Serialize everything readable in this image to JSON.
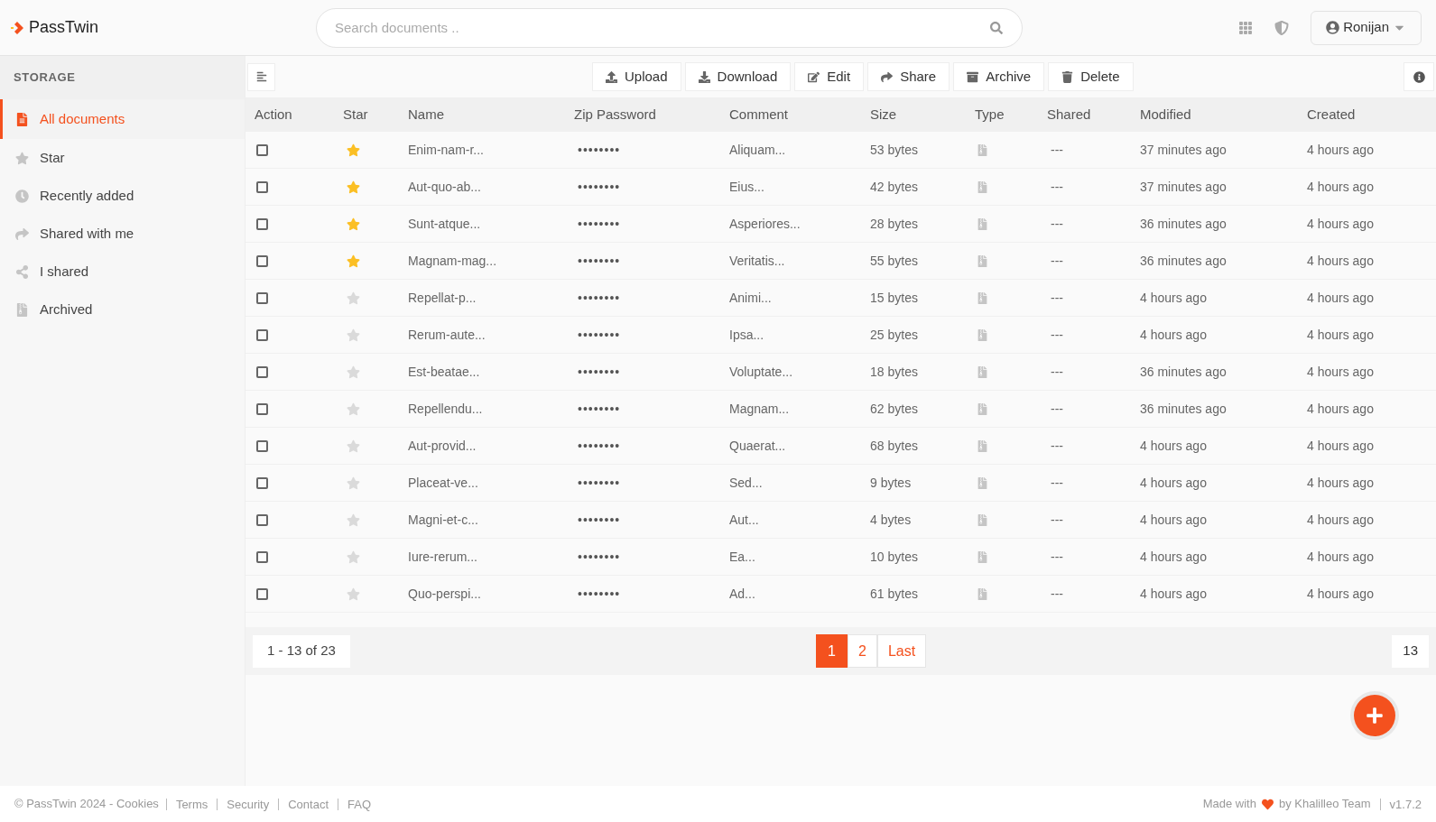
{
  "brand": "PassTwin",
  "search": {
    "placeholder": "Search documents .."
  },
  "user": {
    "name": "Ronijan"
  },
  "sidebar": {
    "heading": "STORAGE",
    "items": [
      {
        "label": "All documents",
        "selected": true,
        "kind": "file"
      },
      {
        "label": "Star",
        "selected": false,
        "kind": "star"
      },
      {
        "label": "Recently added",
        "selected": false,
        "kind": "clock"
      },
      {
        "label": "Shared with me",
        "selected": false,
        "kind": "share"
      },
      {
        "label": "I shared",
        "selected": false,
        "kind": "network"
      },
      {
        "label": "Archived",
        "selected": false,
        "kind": "zip"
      }
    ]
  },
  "toolbar": [
    {
      "label": "Upload",
      "kind": "upload"
    },
    {
      "label": "Download",
      "kind": "download"
    },
    {
      "label": "Edit",
      "kind": "edit"
    },
    {
      "label": "Share",
      "kind": "share"
    },
    {
      "label": "Archive",
      "kind": "archive"
    },
    {
      "label": "Delete",
      "kind": "delete"
    }
  ],
  "table": {
    "columns": [
      "Action",
      "Star",
      "Name",
      "Zip Password",
      "Comment",
      "Size",
      "Type",
      "Shared",
      "Modified",
      "Created"
    ],
    "rows": [
      {
        "checked": false,
        "starred": true,
        "name": "Enim-nam-r...",
        "password": "••••••••",
        "comment": "Aliquam...",
        "size": "53 bytes",
        "shared": "---",
        "modified": "37 minutes ago",
        "created": "4 hours ago"
      },
      {
        "checked": false,
        "starred": true,
        "name": "Aut-quo-ab...",
        "password": "••••••••",
        "comment": "Eius...",
        "size": "42 bytes",
        "shared": "---",
        "modified": "37 minutes ago",
        "created": "4 hours ago"
      },
      {
        "checked": false,
        "starred": true,
        "name": "Sunt-atque...",
        "password": "••••••••",
        "comment": "Asperiores...",
        "size": "28 bytes",
        "shared": "---",
        "modified": "36 minutes ago",
        "created": "4 hours ago"
      },
      {
        "checked": false,
        "starred": true,
        "name": "Magnam-mag...",
        "password": "••••••••",
        "comment": "Veritatis...",
        "size": "55 bytes",
        "shared": "---",
        "modified": "36 minutes ago",
        "created": "4 hours ago"
      },
      {
        "checked": false,
        "starred": false,
        "name": "Repellat-p...",
        "password": "••••••••",
        "comment": "Animi...",
        "size": "15 bytes",
        "shared": "---",
        "modified": "4 hours ago",
        "created": "4 hours ago"
      },
      {
        "checked": false,
        "starred": false,
        "name": "Rerum-aute...",
        "password": "••••••••",
        "comment": "Ipsa...",
        "size": "25 bytes",
        "shared": "---",
        "modified": "4 hours ago",
        "created": "4 hours ago"
      },
      {
        "checked": false,
        "starred": false,
        "name": "Est-beatae...",
        "password": "••••••••",
        "comment": "Voluptate...",
        "size": "18 bytes",
        "shared": "---",
        "modified": "36 minutes ago",
        "created": "4 hours ago"
      },
      {
        "checked": false,
        "starred": false,
        "name": "Repellendu...",
        "password": "••••••••",
        "comment": "Magnam...",
        "size": "62 bytes",
        "shared": "---",
        "modified": "36 minutes ago",
        "created": "4 hours ago"
      },
      {
        "checked": false,
        "starred": false,
        "name": "Aut-provid...",
        "password": "••••••••",
        "comment": "Quaerat...",
        "size": "68 bytes",
        "shared": "---",
        "modified": "4 hours ago",
        "created": "4 hours ago"
      },
      {
        "checked": false,
        "starred": false,
        "name": "Placeat-ve...",
        "password": "••••••••",
        "comment": "Sed...",
        "size": "9 bytes",
        "shared": "---",
        "modified": "4 hours ago",
        "created": "4 hours ago"
      },
      {
        "checked": false,
        "starred": false,
        "name": "Magni-et-c...",
        "password": "••••••••",
        "comment": "Aut...",
        "size": "4 bytes",
        "shared": "---",
        "modified": "4 hours ago",
        "created": "4 hours ago"
      },
      {
        "checked": false,
        "starred": false,
        "name": "Iure-rerum...",
        "password": "••••••••",
        "comment": "Ea...",
        "size": "10 bytes",
        "shared": "---",
        "modified": "4 hours ago",
        "created": "4 hours ago"
      },
      {
        "checked": false,
        "starred": false,
        "name": "Quo-perspi...",
        "password": "••••••••",
        "comment": "Ad...",
        "size": "61 bytes",
        "shared": "---",
        "modified": "4 hours ago",
        "created": "4 hours ago"
      }
    ]
  },
  "pagination": {
    "range": "1 - 13 of 23",
    "pages": [
      {
        "label": "1",
        "selected": true
      },
      {
        "label": "2",
        "selected": false
      },
      {
        "label": "Last",
        "selected": false
      }
    ],
    "per_page": "13"
  },
  "footer": {
    "copyright": "© PassTwin 2024 - Cookies",
    "links": [
      "Terms",
      "Security",
      "Contact",
      "FAQ"
    ],
    "made_with": "Made with",
    "by": "by Khalilleo Team",
    "version": "v1.7.2"
  }
}
